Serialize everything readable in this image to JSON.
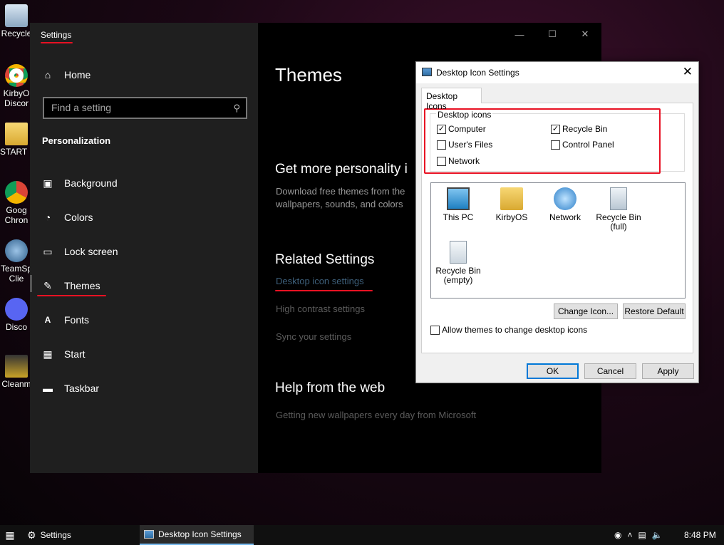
{
  "desktop": {
    "icons": [
      {
        "label": "Recycle",
        "icon": "recycle-bin-icon"
      },
      {
        "label": "KirbyOS Discord",
        "icon": "chrome-icon"
      },
      {
        "label": "START H",
        "icon": "folder-icon"
      },
      {
        "label": "Google Chrome",
        "icon": "chrome-icon"
      },
      {
        "label": "TeamSpeak Client",
        "icon": "teamspeak-icon"
      },
      {
        "label": "Discord",
        "icon": "discord-icon"
      },
      {
        "label": "Cleanm",
        "icon": "shortcut-icon"
      }
    ],
    "icon_labels_line1": [
      "Recycle",
      "KirbyO",
      "START H",
      "Goog",
      "TeamSp",
      "Disco",
      "Cleanm"
    ],
    "icon_labels_line2": [
      "",
      "Discor",
      "",
      "Chron",
      "Clie",
      "",
      ""
    ]
  },
  "settings": {
    "title": "Settings",
    "home": "Home",
    "search_placeholder": "Find a setting",
    "section": "Personalization",
    "nav": [
      {
        "label": "Background",
        "icon": "image-icon"
      },
      {
        "label": "Colors",
        "icon": "palette-icon"
      },
      {
        "label": "Lock screen",
        "icon": "lock-screen-icon"
      },
      {
        "label": "Themes",
        "icon": "brush-icon"
      },
      {
        "label": "Fonts",
        "icon": "font-icon"
      },
      {
        "label": "Start",
        "icon": "start-grid-icon"
      },
      {
        "label": "Taskbar",
        "icon": "taskbar-icon"
      }
    ],
    "selected": "Themes",
    "content": {
      "heading": "Themes",
      "get_more": "Get more personality i",
      "get_more_desc_line1": "Download free themes from the",
      "get_more_desc_line2": "wallpapers, sounds, and colors",
      "related": "Related Settings",
      "related_links": [
        "Desktop icon settings",
        "High contrast settings",
        "Sync your settings"
      ],
      "help": "Help from the web",
      "help_link": "Getting new wallpapers every day from Microsoft"
    }
  },
  "dialog": {
    "title": "Desktop Icon Settings",
    "tab": "Desktop Icons",
    "group_label": "Desktop icons",
    "checkboxes": [
      {
        "label": "Computer",
        "checked": true
      },
      {
        "label": "Recycle Bin",
        "checked": true
      },
      {
        "label": "User's Files",
        "checked": false
      },
      {
        "label": "Control Panel",
        "checked": false
      },
      {
        "label": "Network",
        "checked": false
      }
    ],
    "icons": [
      {
        "label": "This PC",
        "label2": "",
        "icon": "this-pc-icon"
      },
      {
        "label": "KirbyOS",
        "label2": "",
        "icon": "user-folder-icon"
      },
      {
        "label": "Network",
        "label2": "",
        "icon": "network-icon"
      },
      {
        "label": "Recycle Bin",
        "label2": "(full)",
        "icon": "recycle-bin-full-icon"
      },
      {
        "label": "Recycle Bin",
        "label2": "(empty)",
        "icon": "recycle-bin-empty-icon"
      }
    ],
    "change_icon": "Change Icon...",
    "restore_default": "Restore Default",
    "allow_themes": "Allow themes to change desktop icons",
    "allow_themes_checked": false,
    "ok": "OK",
    "cancel": "Cancel",
    "apply": "Apply"
  },
  "taskbar": {
    "settings": "Settings",
    "active_window": "Desktop Icon Settings",
    "time": "8:48 PM"
  },
  "colors": {
    "accent": "#0078d7",
    "annotation_red": "#e81123"
  }
}
